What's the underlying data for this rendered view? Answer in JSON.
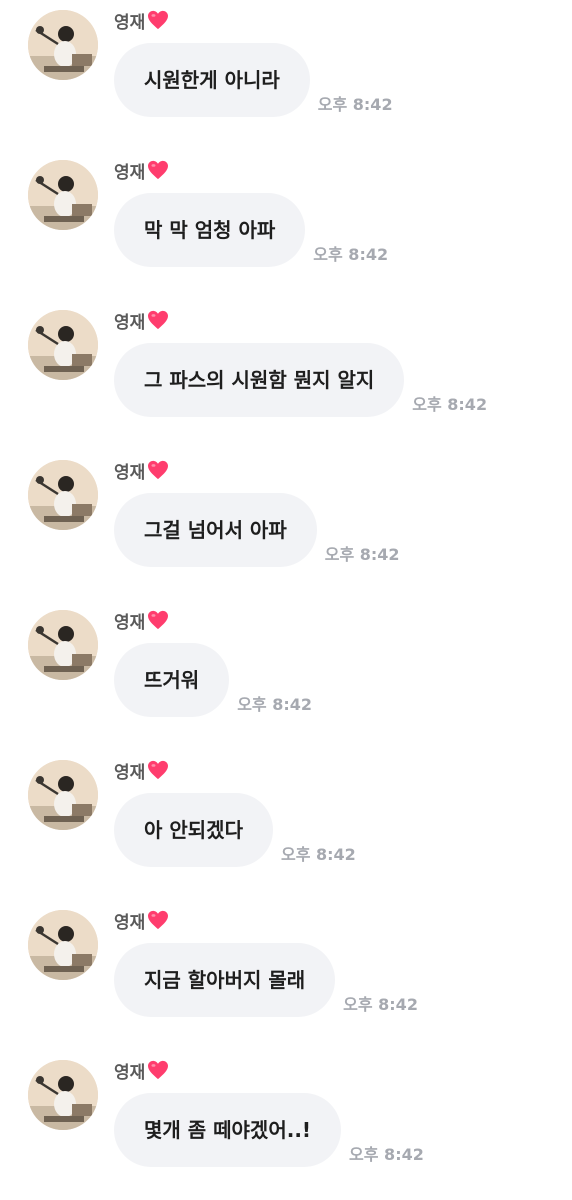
{
  "sender": {
    "name": "영재",
    "heart_icon": "heart-icon",
    "heart_color": "#ff3d6e"
  },
  "avatar_icon": "profile-photo-avatar",
  "colors": {
    "bubble": "#f2f3f6",
    "time": "#a6a9b0",
    "name": "#5a5a5a"
  },
  "messages": [
    {
      "text": "시원한게 아니라",
      "time": "오후 8:42"
    },
    {
      "text": "막 막 엄청 아파",
      "time": "오후 8:42"
    },
    {
      "text": "그 파스의 시원함 뭔지 알지",
      "time": "오후 8:42"
    },
    {
      "text": "그걸 넘어서 아파",
      "time": "오후 8:42"
    },
    {
      "text": "뜨거워",
      "time": "오후 8:42"
    },
    {
      "text": "아 안되겠다",
      "time": "오후 8:42"
    },
    {
      "text": "지금 할아버지 몰래",
      "time": "오후 8:42"
    },
    {
      "text": "몇개 좀 떼야겠어..!",
      "time": "오후 8:42"
    }
  ]
}
